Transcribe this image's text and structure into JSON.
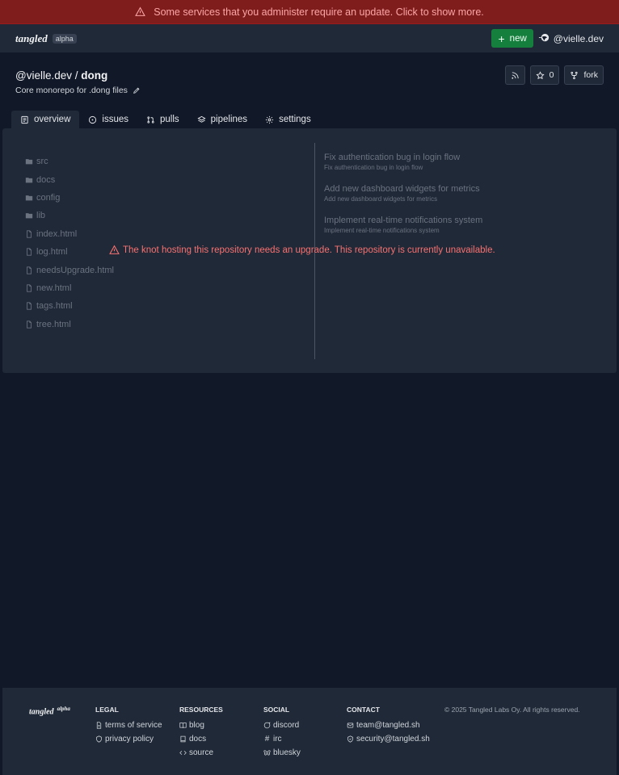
{
  "banner": {
    "text": "Some services that you administer require an update. Click to show more."
  },
  "topbar": {
    "logo": "tangled",
    "badge": "alpha",
    "new_label": "new",
    "user": "@vielle.dev"
  },
  "repo": {
    "owner": "@vielle.dev",
    "separator": " / ",
    "name": "dong",
    "description": "Core monorepo for .dong files",
    "stars": "0",
    "fork_label": "fork"
  },
  "tabs": [
    {
      "label": "overview",
      "icon": "book-icon",
      "active": true
    },
    {
      "label": "issues",
      "icon": "circle-dot-icon"
    },
    {
      "label": "pulls",
      "icon": "git-pull-request-icon"
    },
    {
      "label": "pipelines",
      "icon": "layers-icon"
    },
    {
      "label": "settings",
      "icon": "gear-icon"
    }
  ],
  "files": [
    {
      "name": "src",
      "type": "folder"
    },
    {
      "name": "docs",
      "type": "folder"
    },
    {
      "name": "config",
      "type": "folder"
    },
    {
      "name": "lib",
      "type": "folder"
    },
    {
      "name": "index.html",
      "type": "file"
    },
    {
      "name": "log.html",
      "type": "file"
    },
    {
      "name": "needsUpgrade.html",
      "type": "file"
    },
    {
      "name": "new.html",
      "type": "file"
    },
    {
      "name": "tags.html",
      "type": "file"
    },
    {
      "name": "tree.html",
      "type": "file"
    }
  ],
  "commits": [
    {
      "title": "Fix authentication bug in login flow",
      "subtitle": "Fix authentication bug in login flow"
    },
    {
      "title": "Add new dashboard widgets for metrics",
      "subtitle": "Add new dashboard widgets for metrics"
    },
    {
      "title": "Implement real-time notifications system",
      "subtitle": "Implement real-time notifications system"
    }
  ],
  "warning": "The knot hosting this repository needs an upgrade. This repository is currently unavailable.",
  "footer": {
    "logo": "tangled",
    "badge": "alpha",
    "legal": {
      "heading": "LEGAL",
      "links": [
        "terms of service",
        "privacy policy"
      ]
    },
    "resources": {
      "heading": "RESOURCES",
      "links": [
        "blog",
        "docs",
        "source"
      ]
    },
    "social": {
      "heading": "SOCIAL",
      "links": [
        "discord",
        "irc",
        "bluesky"
      ]
    },
    "contact": {
      "heading": "CONTACT",
      "links": [
        "team@tangled.sh",
        "security@tangled.sh"
      ]
    },
    "copyright": "© 2025 Tangled Labs Oy. All rights reserved."
  },
  "colors": {
    "banner": "#7f1d1d",
    "banner_text": "#fca5a5",
    "primary_button": "#15803d",
    "warning_text": "#f87171",
    "background": "#111827",
    "surface": "#1f2937"
  }
}
